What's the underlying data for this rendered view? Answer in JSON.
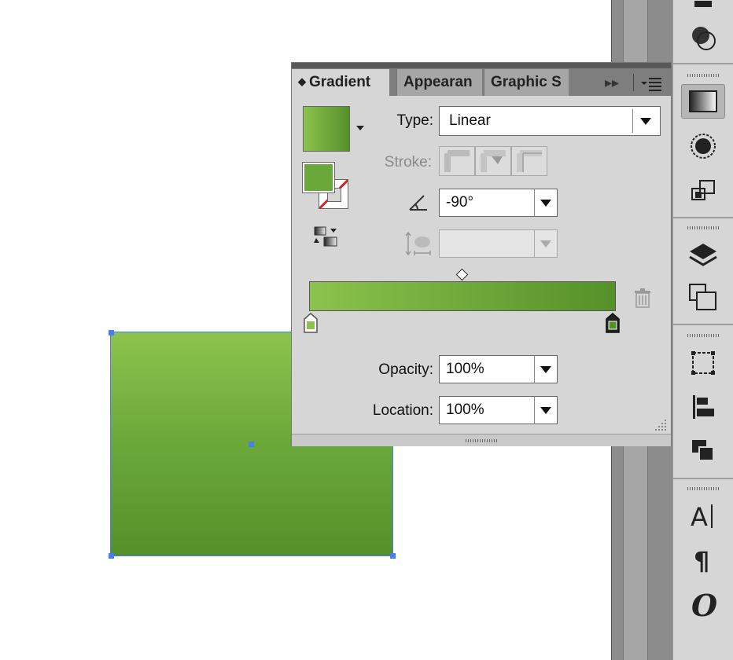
{
  "gradient_panel": {
    "tabs": [
      {
        "label": "Gradient",
        "active": true
      },
      {
        "label": "Appearan",
        "active": false
      },
      {
        "label": "Graphic S",
        "active": false
      }
    ],
    "type_label": "Type:",
    "type_value": "Linear",
    "stroke_label": "Stroke:",
    "angle_value": "-90°",
    "aspect_value": "",
    "opacity_label": "Opacity:",
    "opacity_value": "100%",
    "location_label": "Location:",
    "location_value": "100%"
  },
  "gradient": {
    "start_color": "#8cc34d",
    "end_color": "#559029",
    "selected_stop": "end"
  },
  "dock": {
    "icons": [
      "color-guide-icon",
      "transparency-icon",
      "gradient-icon",
      "stroke-icon",
      "transform-icon",
      "layers-icon",
      "artboards-icon",
      "symbols-icon",
      "align-icon",
      "pathfinder-icon",
      "character-icon",
      "paragraph-icon",
      "opentype-icon"
    ]
  }
}
